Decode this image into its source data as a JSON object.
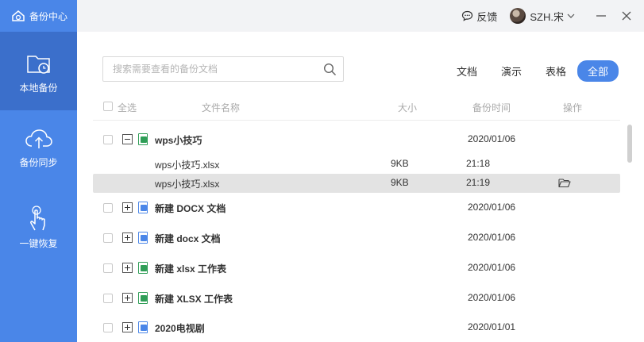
{
  "app": {
    "title": "备份中心"
  },
  "topbar": {
    "feedback": "反馈",
    "username": "SZH.宋"
  },
  "sidebar": {
    "items": [
      {
        "label": "本地备份",
        "icon": "folder-clock-icon"
      },
      {
        "label": "备份同步",
        "icon": "cloud-upload-icon"
      },
      {
        "label": "一键恢复",
        "icon": "hand-touch-icon"
      }
    ]
  },
  "search": {
    "placeholder": "搜索需要查看的备份文档"
  },
  "filters": [
    "文档",
    "演示",
    "表格",
    "全部"
  ],
  "table": {
    "headers": {
      "select_all": "全选",
      "name": "文件名称",
      "size": "大小",
      "time": "备份时间",
      "action": "操作"
    },
    "groups": [
      {
        "name": "wps小技巧",
        "date": "2020/01/06",
        "type": "xlsx",
        "expanded": true,
        "files": [
          {
            "name": "wps小技巧.xlsx",
            "size": "9KB",
            "time": "21:18"
          },
          {
            "name": "wps小技巧.xlsx",
            "size": "9KB",
            "time": "21:19"
          }
        ]
      },
      {
        "name": "新建 DOCX 文档",
        "date": "2020/01/06",
        "type": "docx",
        "expanded": false
      },
      {
        "name": "新建 docx 文档",
        "date": "2020/01/06",
        "type": "docx",
        "expanded": false
      },
      {
        "name": "新建 xlsx 工作表",
        "date": "2020/01/06",
        "type": "xlsx",
        "expanded": false
      },
      {
        "name": "新建 XLSX 工作表",
        "date": "2020/01/06",
        "type": "xlsx",
        "expanded": false
      },
      {
        "name": "2020电视剧",
        "date": "2020/01/01",
        "type": "docx",
        "expanded": false
      }
    ]
  },
  "colors": {
    "accent": "#4a86e8",
    "sidebar_active": "#3b6fcb",
    "xlsx": "#2f9e57",
    "docx": "#4a86e8"
  }
}
